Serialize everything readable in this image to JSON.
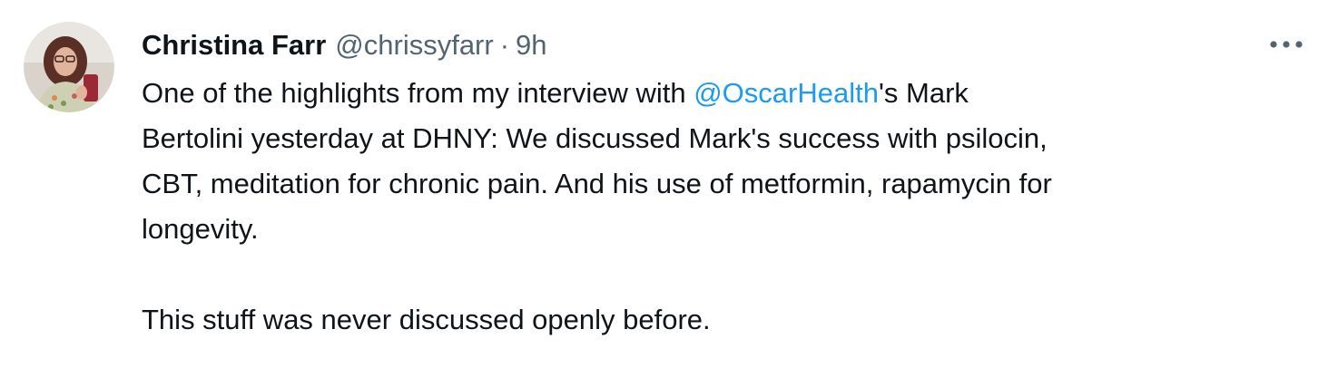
{
  "author": {
    "name": "Christina Farr",
    "handle": "@chrissyfarr",
    "separator": "·",
    "time": "9h"
  },
  "tweet": {
    "p1_before": "One of the highlights from my interview with ",
    "mention": "@OscarHealth",
    "p1_line1_after": "'s Mark",
    "p1_line2": "Bertolini yesterday at DHNY: We discussed Mark's success with psilocin,",
    "p1_line3": "CBT, meditation for chronic pain. And his use of metformin, rapamycin for",
    "p1_line4": "longevity.",
    "p2": "This stuff was never discussed openly before."
  },
  "icons": {
    "more": "more-horizontal-icon",
    "avatar": "avatar-photo"
  },
  "colors": {
    "text": "#0f1419",
    "secondary": "#536471",
    "link": "#1d9bf0"
  }
}
